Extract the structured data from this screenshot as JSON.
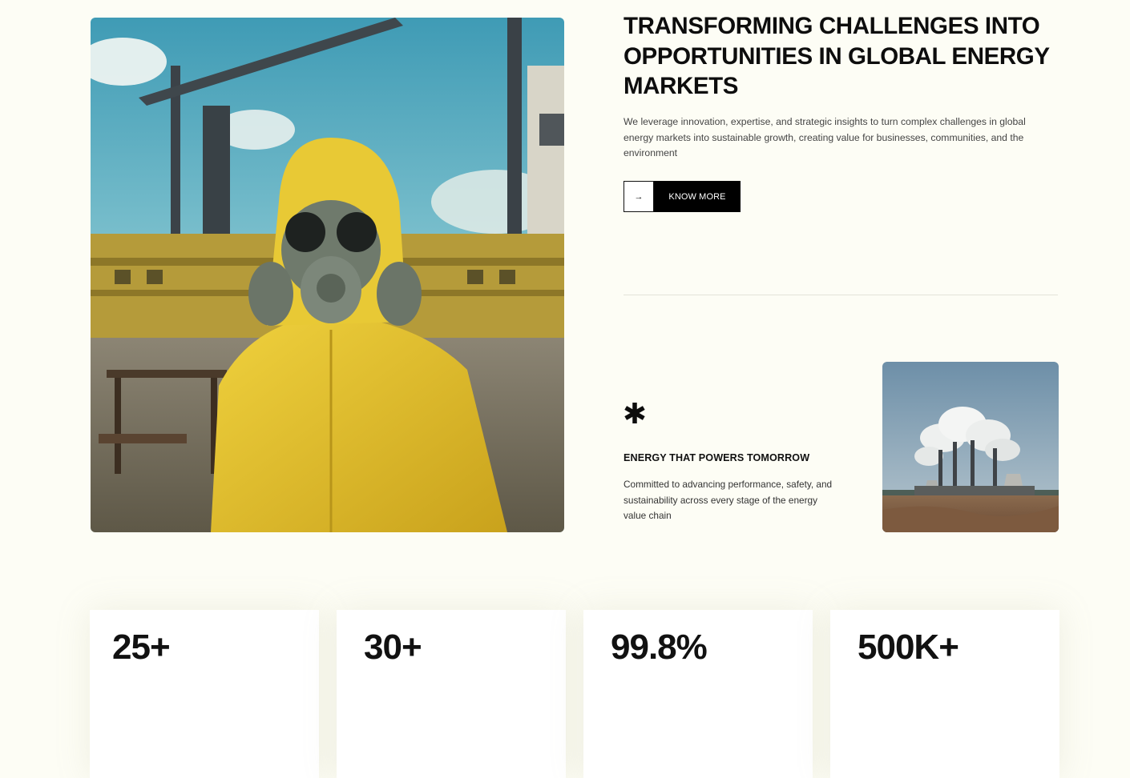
{
  "hero": {
    "image_icon": "hazmat-worker-photo",
    "headline": "TRANSFORMING CHALLENGES INTO OPPORTUNITIES IN GLOBAL ENERGY MARKETS",
    "intro": "We leverage innovation, expertise, and strategic insights to turn complex challenges in global energy markets into sustainable growth, creating value for businesses, communities, and the environment",
    "cta": {
      "arrow": "→",
      "label": "KNOW MORE"
    }
  },
  "feature": {
    "icon": "asterisk-icon",
    "title": "ENERGY THAT POWERS TOMORROW",
    "text": "Committed to advancing performance, safety, and sustainability across every stage of the energy value chain",
    "image_icon": "power-plant-photo"
  },
  "stats": [
    {
      "value": "25+"
    },
    {
      "value": "30+"
    },
    {
      "value": "99.8%"
    },
    {
      "value": "500K+"
    }
  ],
  "colors": {
    "background": "#fdfdf5",
    "text": "#111111",
    "button": "#000000",
    "suit_yellow": "#e4c12e",
    "sky": "#4fa3b8"
  }
}
